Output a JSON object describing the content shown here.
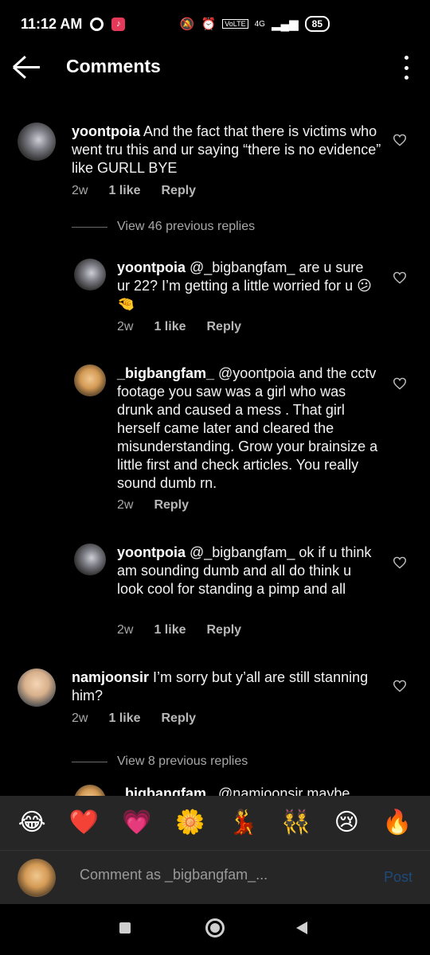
{
  "status_bar": {
    "time": "11:12 AM",
    "network": "4G",
    "volte": "VoLTE",
    "battery": "85"
  },
  "header": {
    "title": "Comments"
  },
  "comments": [
    {
      "username": "yoontpoia",
      "text": " And the fact that there is victims who went tru this and ur saying “there is no evidence” like GURLL BYE",
      "time": "2w",
      "likes": "1 like",
      "reply": "Reply",
      "view_replies": "View 46 previous replies"
    },
    {
      "username": "yoontpoia",
      "text": " @_bigbangfam_ are u sure ur 22? I’m getting a little worried for u ",
      "emoji": "😕🤏",
      "time": "2w",
      "likes": "1 like",
      "reply": "Reply"
    },
    {
      "username": "_bigbangfam_",
      "text": " @yoontpoia and the cctv footage you saw was a girl who was drunk and caused a mess . That girl herself came later and cleared the misunderstanding. Grow your brainsize a little first and check articles. You really sound dumb rn.",
      "time": "2w",
      "reply": "Reply"
    },
    {
      "username": "yoontpoia",
      "text": " @_bigbangfam_ ok if u think am sounding dumb and all do think u look cool for standing a pimp and all",
      "time": "2w",
      "likes": "1 like",
      "reply": "Reply"
    },
    {
      "username": "namjoonsir",
      "text": " I’m sorry but y’all are still stanning him?",
      "time": "2w",
      "likes": "1 like",
      "reply": "Reply",
      "view_replies": "View 8 previous replies"
    },
    {
      "username": "_bigbangfam_",
      "text": " @namjoonsir maybe"
    }
  ],
  "emoji_bar": [
    "😂",
    "❤️",
    "💗",
    "🌼",
    "💃",
    "👯",
    "😢",
    "🔥"
  ],
  "input": {
    "placeholder": "Comment as _bigbangfam_...",
    "post_label": "Post"
  },
  "colors": {
    "background": "#000000",
    "bar_background": "#262626",
    "muted_text": "#a8a8a8",
    "post_disabled": "#1e4a7a"
  }
}
